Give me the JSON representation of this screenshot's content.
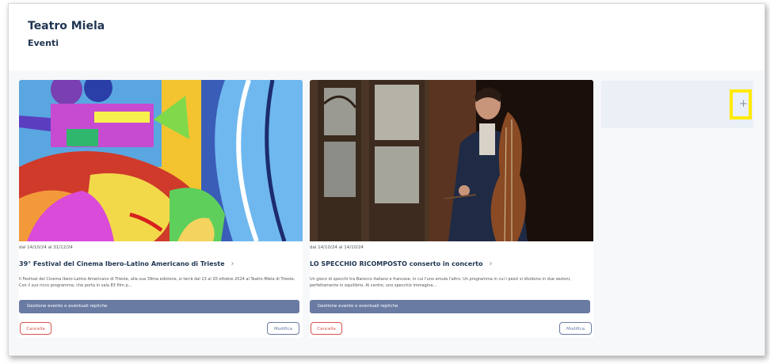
{
  "header": {
    "org_name": "Teatro Miela",
    "section": "Eventi"
  },
  "events": [
    {
      "dates": "dal 14/10/24 al 31/12/24",
      "title": "39° Festival del Cinema Ibero-Latino Americano di Trieste",
      "description": "Il Festival del Cinema Ibero-Latino Americano di Trieste, alla sua 39ma edizione, si terrà dal 13 al 20 ottobre 2024 al Teatro Miela di Trieste. Con il suo ricco programma, che porta in sala 83 film p...",
      "manage_label": "Gestione evento o eventuali repliche",
      "cancel_label": "Cancella",
      "edit_label": "Modifica",
      "image": "colorful-illustration"
    },
    {
      "dates": "dal 14/10/24 al 14/10/24",
      "title": "LO SPECCHIO RICOMPOSTO conserto in concerto",
      "description": "Un gioco di specchi tra Barocco italiano e francese, in cui l'uno emula l'altro. Un programma in cui i pezzi si dividono in due sezioni, perfettamente in equilibrio. Al centro, uno specchio immagina...",
      "manage_label": "Gestione evento o eventuali repliche",
      "cancel_label": "Cancella",
      "edit_label": "Modifica",
      "image": "musician-with-double-bass-photo"
    }
  ],
  "add_event": {
    "icon": "plus-icon",
    "symbol": "+",
    "highlight_color": "#ffea00"
  },
  "colors": {
    "primary": "#1f3552",
    "bar": "#6a7ba3",
    "danger": "#d9534f"
  }
}
